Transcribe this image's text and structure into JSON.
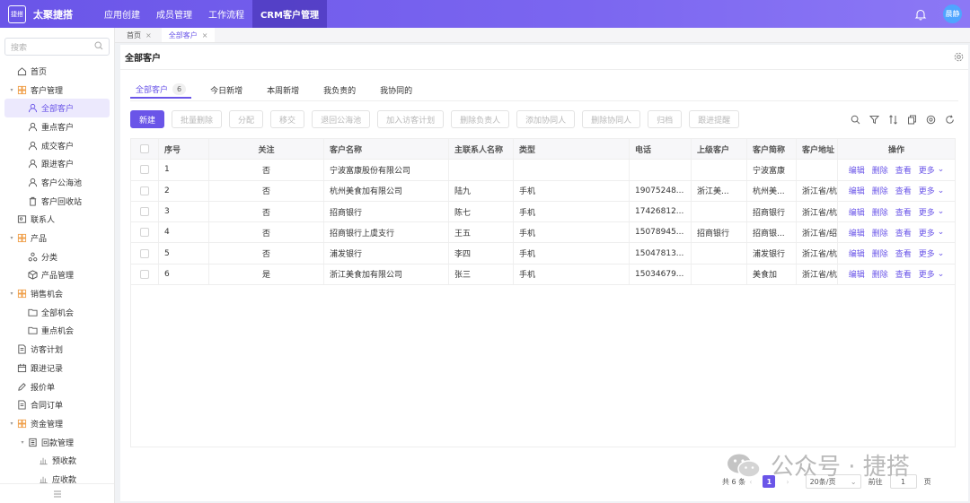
{
  "topbar": {
    "logo_text": "捷搭",
    "brand": "太聚捷搭",
    "nav": [
      "应用创建",
      "成员管理",
      "工作流程",
      "CRM客户管理"
    ],
    "active_nav": "CRM客户管理",
    "avatar_text": "晨静",
    "accent": "#6a55e8"
  },
  "sidebar": {
    "search_placeholder": "搜索",
    "items": [
      {
        "label": "首页",
        "icon": "home-icon",
        "level": 0
      },
      {
        "label": "客户管理",
        "icon": "grid-icon",
        "level": 0,
        "group": true,
        "expanded": true
      },
      {
        "label": "全部客户",
        "icon": "user-icon",
        "level": 1,
        "active": true
      },
      {
        "label": "重点客户",
        "icon": "user-icon",
        "level": 1
      },
      {
        "label": "成交客户",
        "icon": "user-icon",
        "level": 1
      },
      {
        "label": "跟进客户",
        "icon": "user-icon",
        "level": 1
      },
      {
        "label": "客户公海池",
        "icon": "user-icon",
        "level": 1
      },
      {
        "label": "客户回收站",
        "icon": "trash-icon",
        "level": 1
      },
      {
        "label": "联系人",
        "icon": "contact-icon",
        "level": 0
      },
      {
        "label": "产品",
        "icon": "grid-icon",
        "level": 0,
        "group": true,
        "expanded": true
      },
      {
        "label": "分类",
        "icon": "category-icon",
        "level": 1
      },
      {
        "label": "产品管理",
        "icon": "box-icon",
        "level": 1
      },
      {
        "label": "销售机会",
        "icon": "grid-icon",
        "level": 0,
        "group": true,
        "expanded": true
      },
      {
        "label": "全部机会",
        "icon": "folder-icon",
        "level": 1
      },
      {
        "label": "重点机会",
        "icon": "folder-icon",
        "level": 1
      },
      {
        "label": "访客计划",
        "icon": "doc-icon",
        "level": 0
      },
      {
        "label": "跟进记录",
        "icon": "calendar-icon",
        "level": 0
      },
      {
        "label": "报价单",
        "icon": "edit-icon",
        "level": 0
      },
      {
        "label": "合同订单",
        "icon": "doc-icon",
        "level": 0
      },
      {
        "label": "资金管理",
        "icon": "grid-icon",
        "level": 0,
        "group": true,
        "expanded": true
      },
      {
        "label": "回款管理",
        "icon": "list-icon",
        "level": 1,
        "expanded": true
      },
      {
        "label": "预收款",
        "icon": "chart-icon",
        "level": 2
      },
      {
        "label": "应收款",
        "icon": "chart-icon",
        "level": 2
      }
    ],
    "footer_icon": "menu-icon"
  },
  "page_tabs": [
    {
      "label": "首页",
      "active": false
    },
    {
      "label": "全部客户",
      "active": true
    }
  ],
  "page_title": "全部客户",
  "subtabs": [
    {
      "label": "全部客户",
      "count": "6",
      "active": true
    },
    {
      "label": "今日新增"
    },
    {
      "label": "本周新增"
    },
    {
      "label": "我负责的"
    },
    {
      "label": "我协同的"
    }
  ],
  "toolbar": {
    "buttons": [
      "新建",
      "批量删除",
      "分配",
      "移交",
      "退回公海池",
      "加入访客计划",
      "删除负责人",
      "添加协同人",
      "删除协同人",
      "归档",
      "跟进提醒"
    ]
  },
  "table": {
    "columns": [
      "序号",
      "关注",
      "客户名称",
      "主联系人名称",
      "类型",
      "电话",
      "上级客户",
      "客户简称",
      "客户地址",
      "操作"
    ],
    "rows": [
      [
        "1",
        "否",
        "宁波富康股份有限公司",
        "",
        "",
        "",
        "",
        "宁波富康",
        ""
      ],
      [
        "2",
        "否",
        "杭州美食加有限公司",
        "陆九",
        "手机",
        "19075248...",
        "浙江美...",
        "杭州美...",
        "浙江省/杭"
      ],
      [
        "3",
        "否",
        "招商银行",
        "陈七",
        "手机",
        "17426812...",
        "",
        "招商银行",
        "浙江省/杭"
      ],
      [
        "4",
        "否",
        "招商银行上虞支行",
        "王五",
        "手机",
        "15078945...",
        "招商银行",
        "招商银...",
        "浙江省/绍"
      ],
      [
        "5",
        "否",
        "浦发银行",
        "李四",
        "手机",
        "15047813...",
        "",
        "浦发银行",
        "浙江省/杭"
      ],
      [
        "6",
        "是",
        "浙江美食加有限公司",
        "张三",
        "手机",
        "15034679...",
        "",
        "美食加",
        "浙江省/杭"
      ]
    ],
    "row_actions": [
      "编辑",
      "删除",
      "查看",
      "更多"
    ]
  },
  "pager": {
    "total": "共 6 条",
    "current_page": "1",
    "page_size": "20条/页",
    "goto_label": "前往",
    "goto_value": "1",
    "page_suffix": "页"
  },
  "watermark": "公众号 · 捷搭"
}
